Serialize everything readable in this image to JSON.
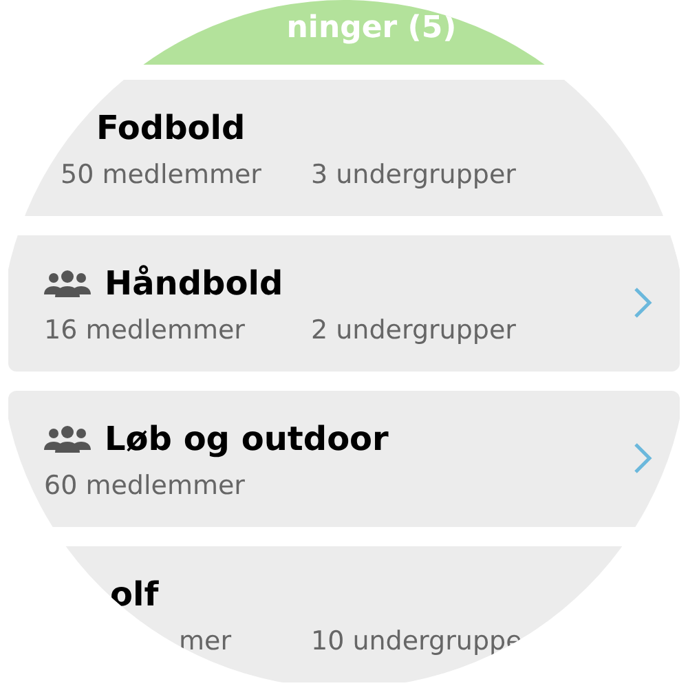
{
  "header": {
    "title": "ninger (5)"
  },
  "groups": [
    {
      "name": "Fodbold",
      "members": "50 medlemmer",
      "subgroups": "3 undergrupper",
      "icon": false
    },
    {
      "name": "Håndbold",
      "members": "16 medlemmer",
      "subgroups": "2 undergrupper",
      "icon": true,
      "chevron": true
    },
    {
      "name": "Løb og outdoor",
      "members": "60 medlemmer",
      "icon": true,
      "chevron": true
    },
    {
      "name": "olf",
      "members": "mer",
      "subgroups": "10 undergruppe",
      "icon": false
    }
  ]
}
